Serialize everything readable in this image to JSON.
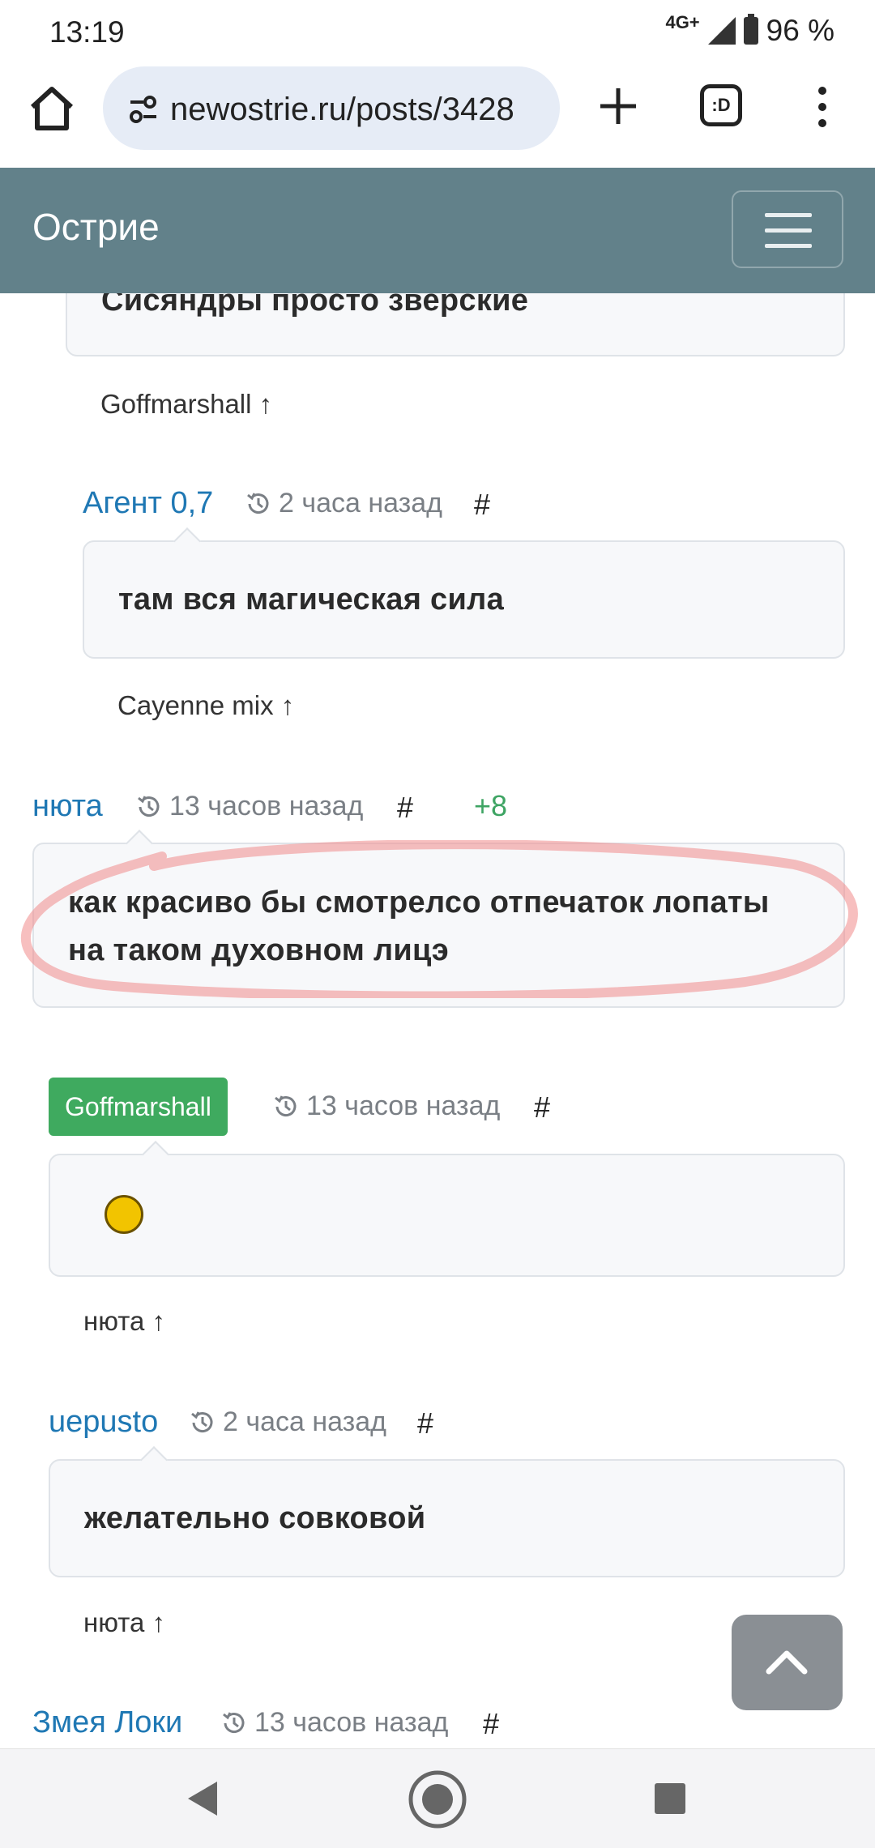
{
  "status": {
    "time": "13:19",
    "network": "4G+",
    "battery": "96 %"
  },
  "browser": {
    "url": "newostrie.ru/posts/3428",
    "tabs_label": ":D"
  },
  "site": {
    "brand": "Острие"
  },
  "comments": [
    {
      "text": "Сисяндры просто зверские",
      "reply_to": "Goffmarshall ↑"
    },
    {
      "author": "Агент 0,7",
      "time": "2 часа назад",
      "hash": "#",
      "text": "там вся магическая сила",
      "reply_to": "Cayenne mix ↑"
    },
    {
      "author": "нюта",
      "time": "13 часов назад",
      "hash": "#",
      "rating": "+8",
      "text_line1": "как красиво бы смотрелсо отпечаток лопаты",
      "text_line2": "на таком духовном лицэ"
    },
    {
      "author": "Goffmarshall",
      "time": "13 часов назад",
      "hash": "#",
      "reply_to": "нюта ↑"
    },
    {
      "author": "uepusto",
      "time": "2 часа назад",
      "hash": "#",
      "text": "желательно совковой",
      "reply_to": "нюта ↑"
    },
    {
      "author": "Змея Локи",
      "time": "13 часов назад",
      "hash": "#"
    }
  ],
  "colors": {
    "navbar": "#62818a",
    "link": "#1f78b4",
    "rating": "#3ea463",
    "badge": "#3faa5f",
    "highlight": "#f08a8a"
  }
}
